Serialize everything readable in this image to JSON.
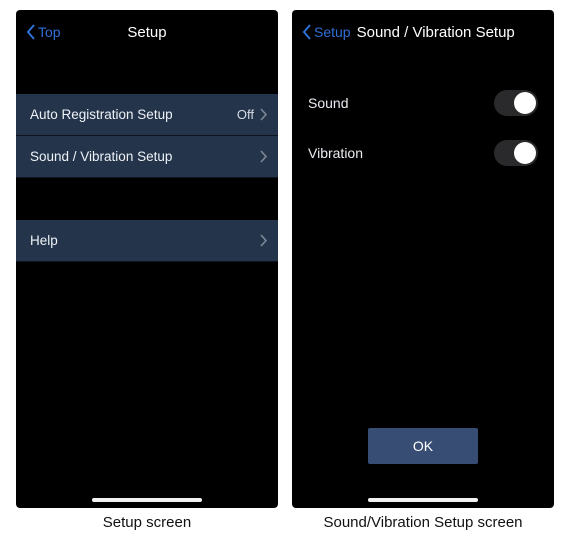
{
  "left": {
    "back_label": "Top",
    "title": "Setup",
    "rows": [
      {
        "label": "Auto Registration Setup",
        "value": "Off"
      },
      {
        "label": "Sound / Vibration Setup",
        "value": ""
      }
    ],
    "help_row": {
      "label": "Help"
    },
    "caption": "Setup screen"
  },
  "right": {
    "back_label": "Setup",
    "title": "Sound / Vibration Setup",
    "toggles": [
      {
        "label": "Sound",
        "on": true
      },
      {
        "label": "Vibration",
        "on": true
      }
    ],
    "ok_label": "OK",
    "caption": "Sound/Vibration Setup screen"
  }
}
